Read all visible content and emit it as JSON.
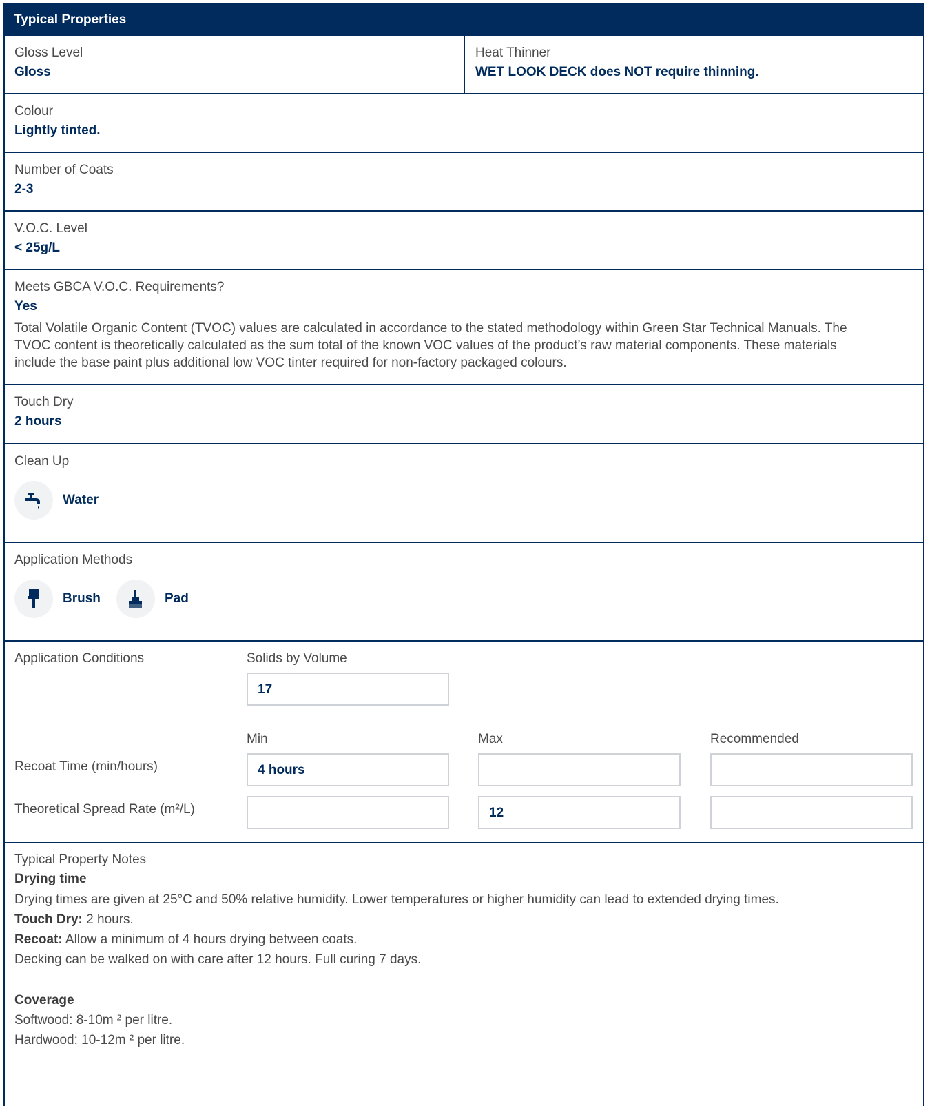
{
  "header": {
    "title": "Typical Properties"
  },
  "gloss": {
    "label": "Gloss Level",
    "value": "Gloss"
  },
  "heat": {
    "label": "Heat Thinner",
    "value": "WET LOOK DECK does NOT require thinning."
  },
  "colour": {
    "label": "Colour",
    "value": "Lightly tinted."
  },
  "coats": {
    "label": "Number of Coats",
    "value": "2-3"
  },
  "voc": {
    "label": "V.O.C. Level",
    "value": "< 25g/L"
  },
  "gbca": {
    "label": "Meets GBCA V.O.C. Requirements?",
    "value": "Yes",
    "note_lines": [
      "Total Volatile Organic Content (TVOC) values are calculated in accordance to the stated methodology within Green Star Technical Manuals. The",
      "TVOC content is theoretically calculated as the sum total of the known VOC values of the product’s raw material components. These materials",
      "include the base paint plus additional low VOC tinter required for non-factory packaged colours."
    ]
  },
  "touch_dry": {
    "label": "Touch Dry",
    "value": "2 hours"
  },
  "clean_up": {
    "label": "Clean Up",
    "items": [
      {
        "icon": "tap-icon",
        "label": "Water"
      }
    ]
  },
  "application_methods": {
    "label": "Application Methods",
    "items": [
      {
        "icon": "brush-icon",
        "label": "Brush"
      },
      {
        "icon": "pad-icon",
        "label": "Pad"
      }
    ]
  },
  "conditions": {
    "label": "Application Conditions",
    "solids_label": "Solids by Volume",
    "solids_value": "17",
    "col_min": "Min",
    "col_max": "Max",
    "col_recommended": "Recommended",
    "recoat": {
      "label": "Recoat Time (min/hours)",
      "min": "4 hours",
      "max": "",
      "recommended": ""
    },
    "spread": {
      "label": "Theoretical Spread Rate (m²/L)",
      "min": "",
      "max": "12",
      "recommended": ""
    }
  },
  "notes": {
    "label": "Typical Property Notes",
    "drying_heading": "Drying time",
    "drying_text": "Drying times are given at 25°C and 50% relative humidity. Lower temperatures or higher humidity can lead to extended drying times.",
    "touch_dry_label": "Touch Dry:",
    "touch_dry_text": " 2 hours.",
    "recoat_label": "Recoat:",
    "recoat_text": " Allow a minimum of 4 hours drying between coats.",
    "walk_text": "Decking can be walked on with care after 12 hours. Full curing 7 days.",
    "coverage_heading": "Coverage",
    "softwood": "Softwood: 8-10m ² per litre.",
    "hardwood": "Hardwood: 10-12m ² per litre."
  },
  "colors": {
    "navy": "#002b5c",
    "text": "#4a4a4a",
    "box_border": "#cfd2d6",
    "icon_bg": "#f1f2f3"
  }
}
